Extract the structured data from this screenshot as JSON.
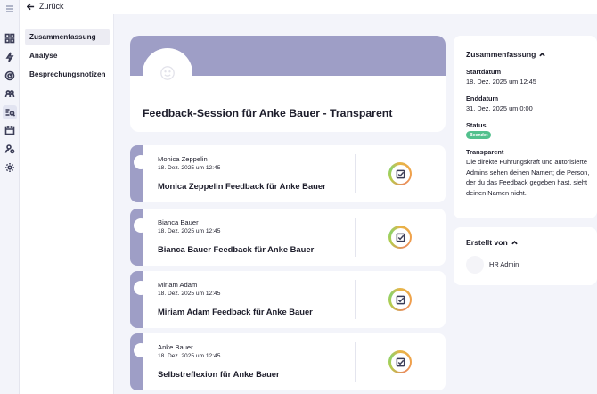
{
  "header": {
    "back_label": "Zurück"
  },
  "subnav": {
    "items": [
      {
        "label": "Zusammenfassung",
        "active": true
      },
      {
        "label": "Analyse",
        "active": false
      },
      {
        "label": "Besprechungsnotizen",
        "active": false
      }
    ]
  },
  "session": {
    "title": "Feedback-Session für Anke Bauer - Transparent"
  },
  "feedbacks": [
    {
      "person": "Monica Zeppelin",
      "date": "18. Dez. 2025 um 12:45",
      "title": "Monica Zeppelin Feedback für Anke Bauer"
    },
    {
      "person": "Bianca Bauer",
      "date": "18. Dez. 2025 um 12:45",
      "title": "Bianca Bauer Feedback für Anke Bauer"
    },
    {
      "person": "Miriam Adam",
      "date": "18. Dez. 2025 um 12:45",
      "title": "Miriam Adam Feedback für Anke Bauer"
    },
    {
      "person": "Anke Bauer",
      "date": "18. Dez. 2025 um 12:45",
      "title": "Selbstreflexion für Anke Bauer"
    }
  ],
  "summary": {
    "heading": "Zusammenfassung",
    "start_label": "Startdatum",
    "start_value": "18. Dez. 2025 um 12:45",
    "end_label": "Enddatum",
    "end_value": "31. Dez. 2025 um 0:00",
    "status_label": "Status",
    "status_value": "Beendet",
    "status_color": "#52c08d",
    "transparency_label": "Transparent",
    "transparency_text": "Die direkte Führungskraft und autorisierte Admins sehen deinen Namen; die Person, der du das Feedback gegeben hast, sieht deinen Namen nicht."
  },
  "creator": {
    "heading": "Erstellt von",
    "name": "HR Admin"
  },
  "colors": {
    "accent": "#9e9ec6",
    "background": "#f3f4fa"
  },
  "icons": {
    "rail": [
      "menu-icon",
      "dashboard-icon",
      "lightning-icon",
      "target-icon",
      "people-icon",
      "feedback-list-icon",
      "calendar-icon",
      "user-gear-icon",
      "settings-icon"
    ]
  }
}
